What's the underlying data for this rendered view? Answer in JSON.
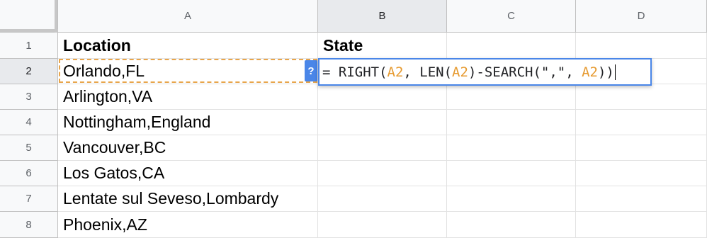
{
  "columns": [
    "A",
    "B",
    "C",
    "D"
  ],
  "rows": [
    "1",
    "2",
    "3",
    "4",
    "5",
    "6",
    "7",
    "8"
  ],
  "column_a": [
    "Location",
    "Orlando,FL",
    "Arlington,VA",
    "Nottingham,England",
    "Vancouver,BC",
    "Los Gatos,CA",
    "Lentate sul Seveso,Lombardy",
    "Phoenix,AZ"
  ],
  "column_b_header": "State",
  "active_cell": "B2",
  "formula": {
    "p1": "= RIGHT(",
    "r1": "A2",
    "p2": ", LEN(",
    "r2": "A2",
    "p3": ")-SEARCH(\",\", ",
    "r3": "A2",
    "p4": "))"
  },
  "help_button": "?",
  "colors": {
    "selection_blue": "#4a86e8",
    "copy_border_orange": "#e8a54b",
    "reference_orange": "#e69a30"
  }
}
